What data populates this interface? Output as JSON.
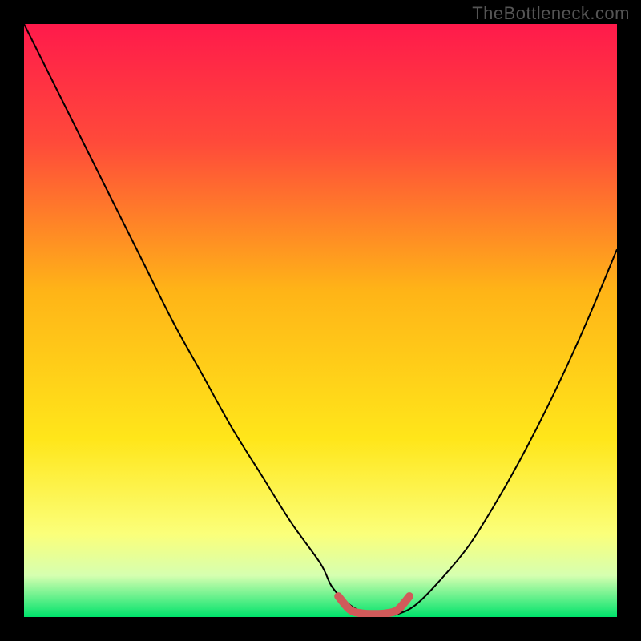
{
  "watermark": "TheBottleneck.com",
  "chart_data": {
    "type": "line",
    "title": "",
    "xlabel": "",
    "ylabel": "",
    "xlim": [
      0,
      100
    ],
    "ylim": [
      0,
      100
    ],
    "background_gradient_stops": [
      {
        "offset": 0.0,
        "color": "#ff1a4b"
      },
      {
        "offset": 0.2,
        "color": "#ff4a3a"
      },
      {
        "offset": 0.45,
        "color": "#ffb417"
      },
      {
        "offset": 0.7,
        "color": "#ffe61a"
      },
      {
        "offset": 0.86,
        "color": "#fbff7a"
      },
      {
        "offset": 0.93,
        "color": "#d6ffb0"
      },
      {
        "offset": 1.0,
        "color": "#00e36b"
      }
    ],
    "series": [
      {
        "name": "bottleneck-curve",
        "color": "#000000",
        "x": [
          0,
          5,
          10,
          15,
          20,
          25,
          30,
          35,
          40,
          45,
          50,
          52,
          55,
          58,
          61,
          63,
          66,
          70,
          75,
          80,
          85,
          90,
          95,
          100
        ],
        "y": [
          100,
          90,
          80,
          70,
          60,
          50,
          41,
          32,
          24,
          16,
          9,
          5,
          2,
          0.5,
          0.3,
          0.5,
          2,
          6,
          12,
          20,
          29,
          39,
          50,
          62
        ]
      },
      {
        "name": "optimal-zone-marker",
        "color": "#d15a5a",
        "x": [
          53,
          55,
          57,
          59,
          61,
          63,
          65
        ],
        "y": [
          3.5,
          1.2,
          0.6,
          0.5,
          0.6,
          1.2,
          3.5
        ]
      }
    ]
  }
}
